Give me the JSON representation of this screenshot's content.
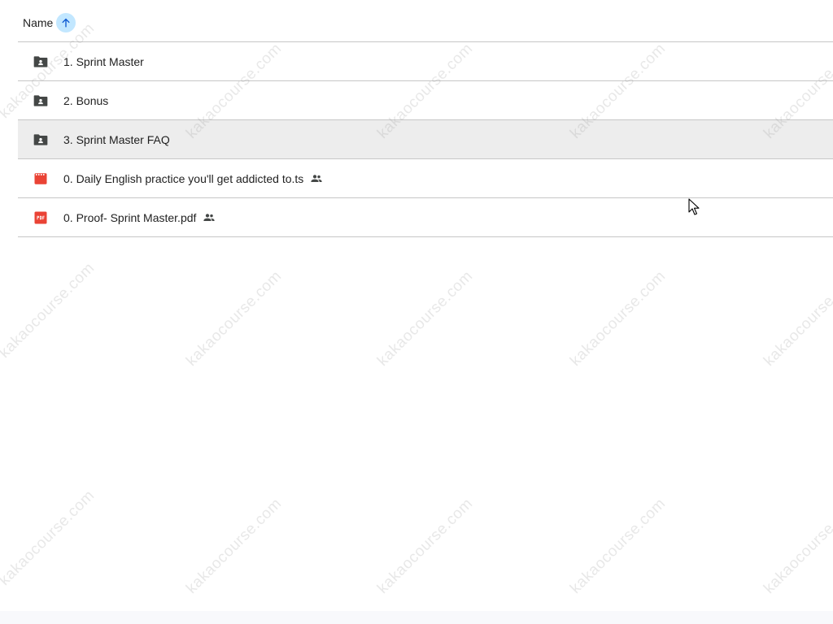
{
  "header": {
    "column_label": "Name",
    "sort_icon": "arrow-up-icon"
  },
  "files": [
    {
      "name": "1. Sprint Master",
      "icon": "shared-folder-icon",
      "shared": false,
      "selected": false
    },
    {
      "name": "2. Bonus",
      "icon": "shared-folder-icon",
      "shared": false,
      "selected": false
    },
    {
      "name": "3. Sprint Master FAQ",
      "icon": "shared-folder-icon",
      "shared": false,
      "selected": true
    },
    {
      "name": "0. Daily English practice you'll get addicted to.ts",
      "icon": "video-icon",
      "shared": true,
      "selected": false
    },
    {
      "name": "0. Proof- Sprint Master.pdf",
      "icon": "pdf-icon",
      "shared": true,
      "selected": false
    }
  ],
  "watermark": {
    "text": "kakaocourse.com"
  },
  "colors": {
    "sort_button_bg": "#c2e7ff",
    "selected_row_bg": "#ededed",
    "folder_icon": "#444746",
    "video_icon": "#ea4335",
    "pdf_icon": "#ea4335"
  }
}
